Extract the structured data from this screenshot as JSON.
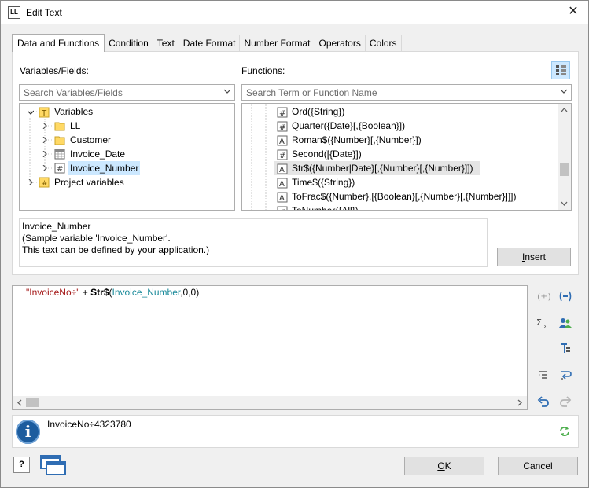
{
  "window": {
    "app_icon_text": "LL",
    "title": "Edit Text",
    "close_glyph": "✕"
  },
  "tabs": [
    "Data and Functions",
    "Condition",
    "Text",
    "Date Format",
    "Number Format",
    "Operators",
    "Colors"
  ],
  "variables": {
    "label": "Variables/Fields:",
    "search_placeholder": "Search Variables/Fields",
    "tree": [
      {
        "label": "Variables",
        "icon": "variables-folder-icon"
      },
      {
        "label": "LL",
        "icon": "folder-icon"
      },
      {
        "label": "Customer",
        "icon": "folder-icon"
      },
      {
        "label": "Invoice_Date",
        "icon": "date-icon"
      },
      {
        "label": "Invoice_Number",
        "icon": "number-icon",
        "selected": true
      },
      {
        "label": "Project variables",
        "icon": "project-variables-icon"
      }
    ]
  },
  "functions": {
    "label": "Functions:",
    "search_placeholder": "Search Term or Function Name",
    "items": [
      {
        "label": "Ord({String})",
        "icon": "number-icon"
      },
      {
        "label": "Quarter({Date}[,{Boolean}])",
        "icon": "number-icon"
      },
      {
        "label": "Roman$({Number}[,{Number}])",
        "icon": "text-icon"
      },
      {
        "label": "Second([{Date}])",
        "icon": "number-icon"
      },
      {
        "label": "Str$({Number|Date}[,{Number}[,{Number}]])",
        "icon": "text-icon",
        "highlighted": true
      },
      {
        "label": "Time$({String})",
        "icon": "text-icon"
      },
      {
        "label": "ToFrac$({Number},[{Boolean}[,{Number}[,{Number}]]])",
        "icon": "text-icon"
      },
      {
        "label": "ToNumber({All})",
        "icon": "number-icon"
      }
    ]
  },
  "description": {
    "line1": "Invoice_Number",
    "line2": "(Sample variable 'Invoice_Number'.",
    "line3": "This text can be defined by your application.)"
  },
  "insert_label": "Insert",
  "expression": {
    "string_literal": "\"InvoiceNo÷\"",
    "operator": " + ",
    "function_name": "Str$",
    "open_paren": "(",
    "field": "Invoice_Number",
    "args": ",0,0)"
  },
  "result": {
    "text": "InvoiceNo÷4323780"
  },
  "buttons": {
    "ok": "OK",
    "cancel": "Cancel",
    "help": "?"
  },
  "colors": {
    "string": "#a31515",
    "field": "#1a8a9a",
    "accent": "#1c5c9e",
    "selection": "#cce8ff"
  }
}
